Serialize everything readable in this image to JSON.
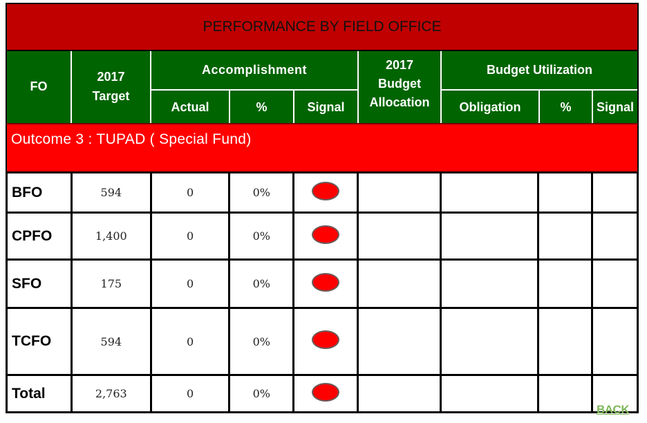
{
  "title": "PERFORMANCE BY FIELD OFFICE",
  "header": {
    "fo": "FO",
    "target_line1": "2017",
    "target_line2": "Target",
    "accomplishment": "Accomplishment",
    "actual": "Actual",
    "acc_percent": "%",
    "acc_signal": "Signal",
    "budget_line1": "2017",
    "budget_line2": "Budget",
    "budget_line3": "Allocation",
    "budget_utilization": "Budget Utilization",
    "obligation": "Obligation",
    "bu_percent": "%",
    "bu_signal": "Signal"
  },
  "outcome": "Outcome 3 : TUPAD ( Special Fund)",
  "rows": [
    {
      "fo": "BFO",
      "target": "594",
      "actual": "0",
      "percent": "0%",
      "signal": "red",
      "budget": "",
      "obligation": "",
      "bu_percent": "",
      "bu_signal": ""
    },
    {
      "fo": "CPFO",
      "target": "1,400",
      "actual": "0",
      "percent": "0%",
      "signal": "red",
      "budget": "",
      "obligation": "",
      "bu_percent": "",
      "bu_signal": ""
    },
    {
      "fo": "SFO",
      "target": "175",
      "actual": "0",
      "percent": "0%",
      "signal": "red",
      "budget": "",
      "obligation": "",
      "bu_percent": "",
      "bu_signal": ""
    },
    {
      "fo": "TCFO",
      "target": "594",
      "actual": "0",
      "percent": "0%",
      "signal": "red",
      "budget": "",
      "obligation": "",
      "bu_percent": "",
      "bu_signal": ""
    },
    {
      "fo": "Total",
      "target": "2,763",
      "actual": "0",
      "percent": "0%",
      "signal": "red",
      "budget": "",
      "obligation": "",
      "bu_percent": "",
      "bu_signal": ""
    }
  ],
  "colors": {
    "title_bg": "#c00000",
    "header_bg": "#006400",
    "outcome_bg": "#ff0000",
    "signal_red": "#ff0000",
    "back_link": "#7fb85a"
  },
  "back_label": "BACK"
}
